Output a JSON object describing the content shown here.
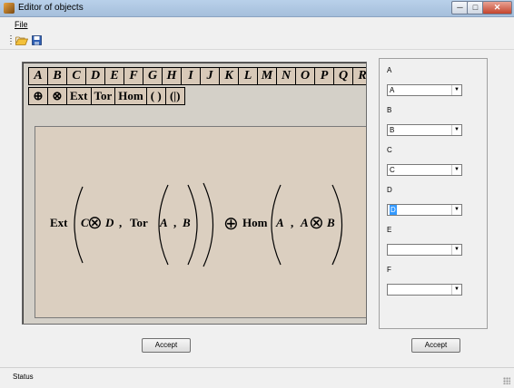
{
  "window": {
    "title": "Editor of objects",
    "minimize_glyph": "─",
    "maximize_glyph": "□",
    "close_glyph": "✕"
  },
  "menu": {
    "file_label": "File"
  },
  "toolbar": {
    "open_icon": "open-folder-icon",
    "save_icon": "save-disk-icon"
  },
  "palette": {
    "letters": [
      "A",
      "B",
      "C",
      "D",
      "E",
      "F",
      "G",
      "H",
      "I",
      "J",
      "K",
      "L",
      "M",
      "N",
      "O",
      "P",
      "Q",
      "R"
    ],
    "operators": [
      "⊕",
      "⊗",
      "Ext",
      "Tor",
      "Hom",
      "( )",
      "(|)"
    ]
  },
  "formula": {
    "ext": "Ext",
    "c": "C",
    "otimes": "⊗",
    "d": "D",
    "comma": ",",
    "tor": "Tor",
    "a": "A",
    "b": "B",
    "oplus": "⊕",
    "hom": "Hom"
  },
  "selectors": [
    {
      "label": "A",
      "value": "A",
      "selected": false
    },
    {
      "label": "B",
      "value": "B",
      "selected": false
    },
    {
      "label": "C",
      "value": "C",
      "selected": false
    },
    {
      "label": "D",
      "value": "D",
      "selected": true
    },
    {
      "label": "E",
      "value": "",
      "selected": false
    },
    {
      "label": "F",
      "value": "",
      "selected": false
    }
  ],
  "buttons": {
    "accept_left": "Accept",
    "accept_right": "Accept"
  },
  "status": {
    "text": "Status"
  },
  "colors": {
    "titlebar": "#b9d1ea",
    "panel": "#d4d0c8",
    "canvas": "#dbcfc0",
    "key": "#d8c9b8",
    "selection": "#3399ff"
  }
}
